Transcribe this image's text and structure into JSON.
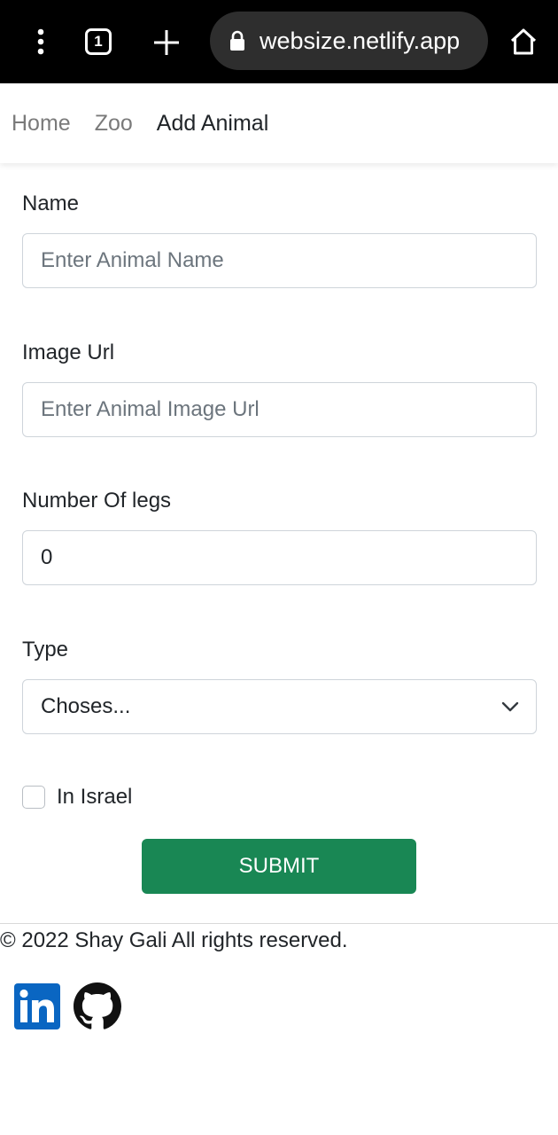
{
  "browser": {
    "tab_count": "1",
    "url": "websize.netlify.app",
    "icons": [
      "menu-dots-icon",
      "tabs-icon",
      "plus-icon",
      "lock-icon",
      "home-icon"
    ]
  },
  "nav": {
    "items": [
      "Home",
      "Zoo",
      "Add Animal"
    ],
    "active": "Add Animal"
  },
  "form": {
    "name": {
      "label": "Name",
      "placeholder": "Enter Animal Name"
    },
    "image_url": {
      "label": "Image Url",
      "placeholder": "Enter Animal Image Url"
    },
    "legs": {
      "label": "Number Of legs",
      "value": "0"
    },
    "type": {
      "label": "Type",
      "selected": "Choses..."
    },
    "in_israel": {
      "label": "In Israel",
      "checked": false
    },
    "submit_label": "SUBMIT"
  },
  "footer": {
    "copyright": "© 2022 Shay Gali All rights reserved.",
    "social_icons": [
      "linkedin-icon",
      "github-icon"
    ]
  },
  "colors": {
    "submit_bg": "#198754",
    "linkedin": "#0a66c2",
    "chrome_bg": "#000000"
  }
}
